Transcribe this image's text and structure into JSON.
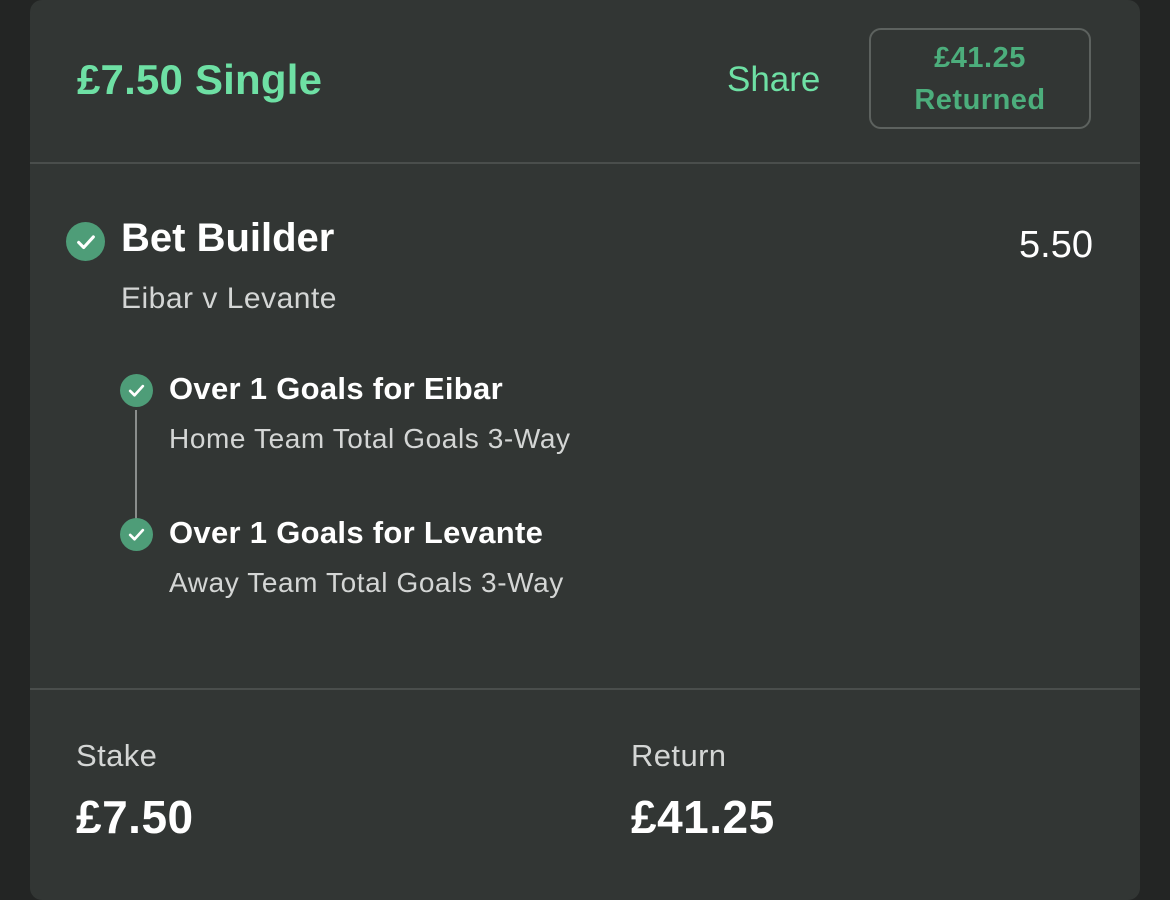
{
  "header": {
    "title": "£7.50 Single",
    "share_label": "Share",
    "returned_amount": "£41.25",
    "returned_label": "Returned"
  },
  "bet": {
    "type": "Bet Builder",
    "odds": "5.50",
    "match": "Eibar v Levante",
    "legs": [
      {
        "title": "Over 1 Goals for Eibar",
        "market": "Home Team Total Goals 3-Way"
      },
      {
        "title": "Over 1 Goals for Levante",
        "market": "Away Team Total Goals 3-Way"
      }
    ]
  },
  "summary": {
    "stake_label": "Stake",
    "stake_value": "£7.50",
    "return_label": "Return",
    "return_value": "£41.25"
  },
  "colors": {
    "accent": "#6ee0a4",
    "accent_dark": "#4cae7c",
    "check_bg": "#4e9d78",
    "card_bg": "#323634",
    "page_bg": "#232524"
  },
  "icons": {
    "status": "check-circle-icon"
  }
}
